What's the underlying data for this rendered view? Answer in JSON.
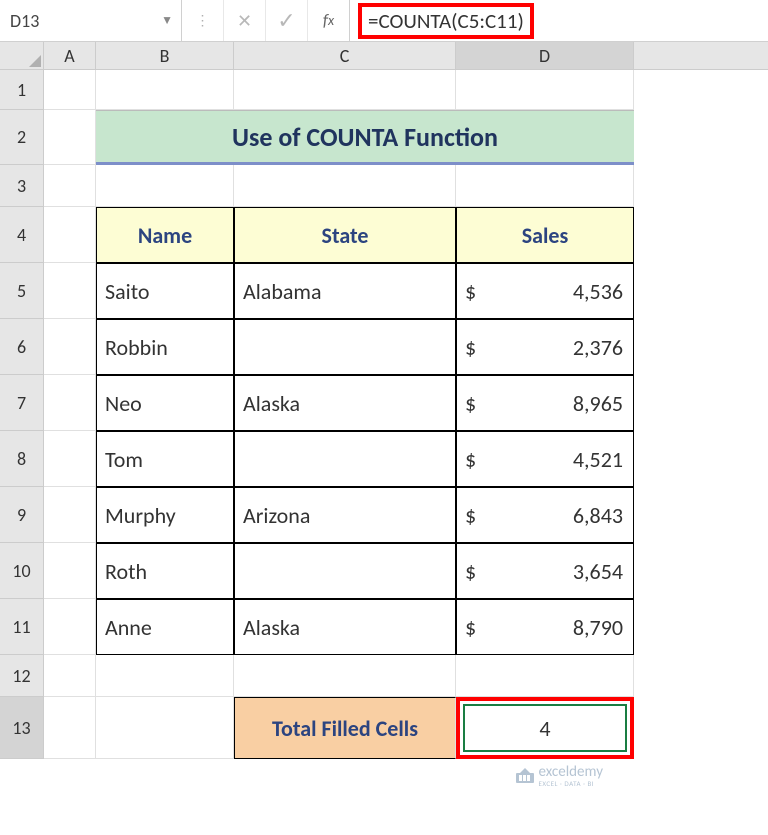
{
  "nameBox": "D13",
  "formula": "=COUNTA(C5:C11)",
  "columns": [
    "A",
    "B",
    "C",
    "D"
  ],
  "rows": [
    "1",
    "2",
    "3",
    "4",
    "5",
    "6",
    "7",
    "8",
    "9",
    "10",
    "11",
    "12",
    "13"
  ],
  "title": "Use of COUNTA Function",
  "headers": {
    "name": "Name",
    "state": "State",
    "sales": "Sales"
  },
  "data": [
    {
      "name": "Saito",
      "state": "Alabama",
      "currency": "$",
      "sales": "4,536"
    },
    {
      "name": "Robbin",
      "state": "",
      "currency": "$",
      "sales": "2,376"
    },
    {
      "name": "Neo",
      "state": "Alaska",
      "currency": "$",
      "sales": "8,965"
    },
    {
      "name": "Tom",
      "state": "",
      "currency": "$",
      "sales": "4,521"
    },
    {
      "name": "Murphy",
      "state": "Arizona",
      "currency": "$",
      "sales": "6,843"
    },
    {
      "name": "Roth",
      "state": "",
      "currency": "$",
      "sales": "3,654"
    },
    {
      "name": "Anne",
      "state": "Alaska",
      "currency": "$",
      "sales": "8,790"
    }
  ],
  "totalLabel": "Total Filled Cells",
  "result": "4",
  "watermark": {
    "brand": "exceldemy",
    "tagline": "EXCEL · DATA · BI"
  }
}
